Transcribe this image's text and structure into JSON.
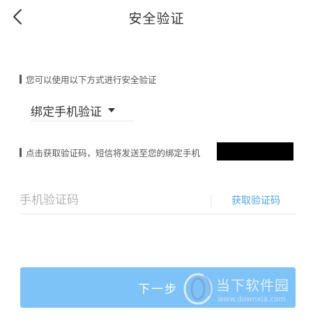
{
  "header": {
    "title": "安全验证",
    "back_icon": "chevron-left-icon"
  },
  "verify_methods": {
    "hint": "您可以使用以下方式进行安全验证",
    "selected": "绑定手机验证"
  },
  "sms": {
    "hint": "点击获取验证码，短信将发送至您的绑定手机",
    "code_placeholder": "手机验证码",
    "get_code_label": "获取验证码"
  },
  "footer": {
    "next_label": "下一步"
  },
  "watermark": {
    "name": "当下软件园",
    "url": "www.downxia.com"
  },
  "colors": {
    "accent": "#4aa6ef",
    "button_bg": "#7ec3f8",
    "text": "#333333",
    "placeholder": "#b5b5b5"
  }
}
